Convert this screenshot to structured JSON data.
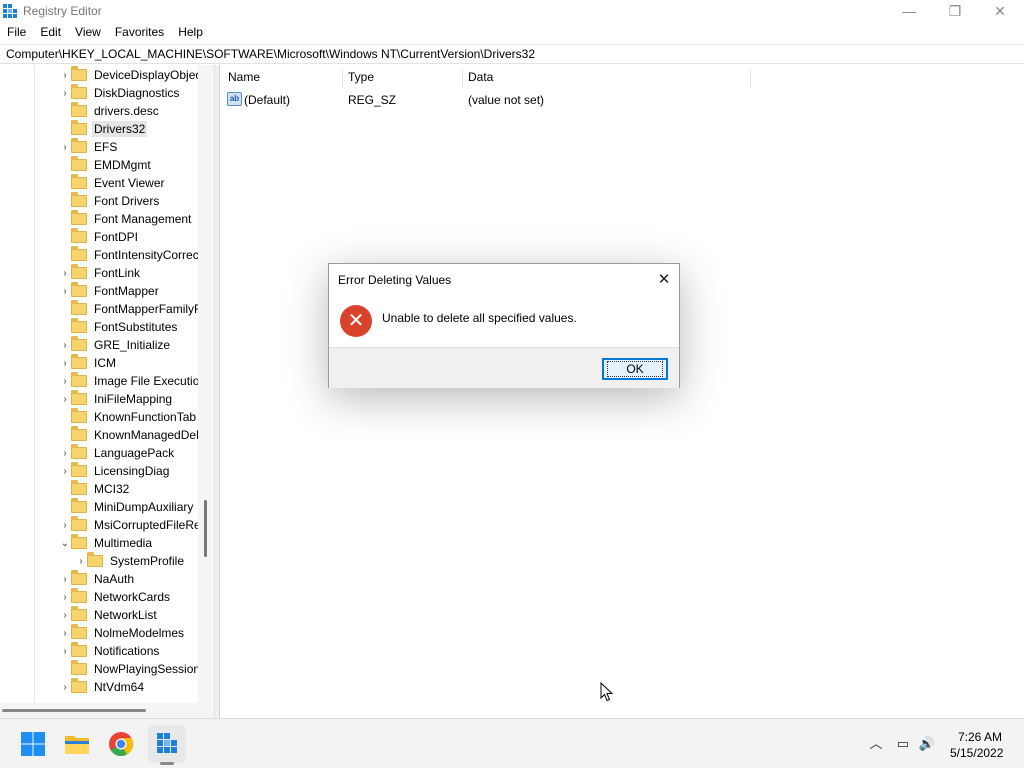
{
  "window": {
    "title": "Registry Editor",
    "min_glyph": "—",
    "max_glyph": "❐",
    "close_glyph": "✕"
  },
  "menu": [
    "File",
    "Edit",
    "View",
    "Favorites",
    "Help"
  ],
  "address": "Computer\\HKEY_LOCAL_MACHINE\\SOFTWARE\\Microsoft\\Windows NT\\CurrentVersion\\Drivers32",
  "tree": {
    "items": [
      {
        "label": "DeviceDisplayObjec",
        "expander": "›",
        "level": 0
      },
      {
        "label": "DiskDiagnostics",
        "expander": "›",
        "level": 0
      },
      {
        "label": "drivers.desc",
        "expander": "",
        "level": 0
      },
      {
        "label": "Drivers32",
        "expander": "",
        "level": 0,
        "selected": true
      },
      {
        "label": "EFS",
        "expander": "›",
        "level": 0
      },
      {
        "label": "EMDMgmt",
        "expander": "",
        "level": 0
      },
      {
        "label": "Event Viewer",
        "expander": "",
        "level": 0
      },
      {
        "label": "Font Drivers",
        "expander": "",
        "level": 0
      },
      {
        "label": "Font Management",
        "expander": "",
        "level": 0
      },
      {
        "label": "FontDPI",
        "expander": "",
        "level": 0
      },
      {
        "label": "FontIntensityCorrec",
        "expander": "",
        "level": 0
      },
      {
        "label": "FontLink",
        "expander": "›",
        "level": 0
      },
      {
        "label": "FontMapper",
        "expander": "›",
        "level": 0
      },
      {
        "label": "FontMapperFamilyF",
        "expander": "",
        "level": 0
      },
      {
        "label": "FontSubstitutes",
        "expander": "",
        "level": 0
      },
      {
        "label": "GRE_Initialize",
        "expander": "›",
        "level": 0
      },
      {
        "label": "ICM",
        "expander": "›",
        "level": 0
      },
      {
        "label": "Image File Executio",
        "expander": "›",
        "level": 0
      },
      {
        "label": "IniFileMapping",
        "expander": "›",
        "level": 0
      },
      {
        "label": "KnownFunctionTab",
        "expander": "",
        "level": 0
      },
      {
        "label": "KnownManagedDel",
        "expander": "",
        "level": 0
      },
      {
        "label": "LanguagePack",
        "expander": "›",
        "level": 0
      },
      {
        "label": "LicensingDiag",
        "expander": "›",
        "level": 0
      },
      {
        "label": "MCI32",
        "expander": "",
        "level": 0
      },
      {
        "label": "MiniDumpAuxiliary",
        "expander": "",
        "level": 0
      },
      {
        "label": "MsiCorruptedFileRe",
        "expander": "›",
        "level": 0
      },
      {
        "label": "Multimedia",
        "expander": "⌄",
        "level": 0
      },
      {
        "label": "SystemProfile",
        "expander": "›",
        "level": 1
      },
      {
        "label": "NaAuth",
        "expander": "›",
        "level": 0
      },
      {
        "label": "NetworkCards",
        "expander": "›",
        "level": 0
      },
      {
        "label": "NetworkList",
        "expander": "›",
        "level": 0
      },
      {
        "label": "NolmeModelmes",
        "expander": "›",
        "level": 0
      },
      {
        "label": "Notifications",
        "expander": "›",
        "level": 0
      },
      {
        "label": "NowPlayingSession",
        "expander": "",
        "level": 0
      },
      {
        "label": "NtVdm64",
        "expander": "›",
        "level": 0
      }
    ]
  },
  "list": {
    "columns": [
      "Name",
      "Type",
      "Data"
    ],
    "rows": [
      {
        "icon": "ab",
        "name": "(Default)",
        "type": "REG_SZ",
        "data": "(value not set)"
      }
    ]
  },
  "dialog": {
    "title": "Error Deleting Values",
    "close_glyph": "✕",
    "icon_glyph": "✕",
    "message": "Unable to delete all specified values.",
    "ok_label": "OK"
  },
  "taskbar": {
    "apps": [
      "start-icon",
      "file-explorer-icon",
      "chrome-icon",
      "registry-editor-icon"
    ],
    "tray": {
      "chevron_glyph": "︿",
      "network_glyph": "▭",
      "volume_glyph": "🔊"
    },
    "time": "7:26 AM",
    "date": "5/15/2022"
  }
}
